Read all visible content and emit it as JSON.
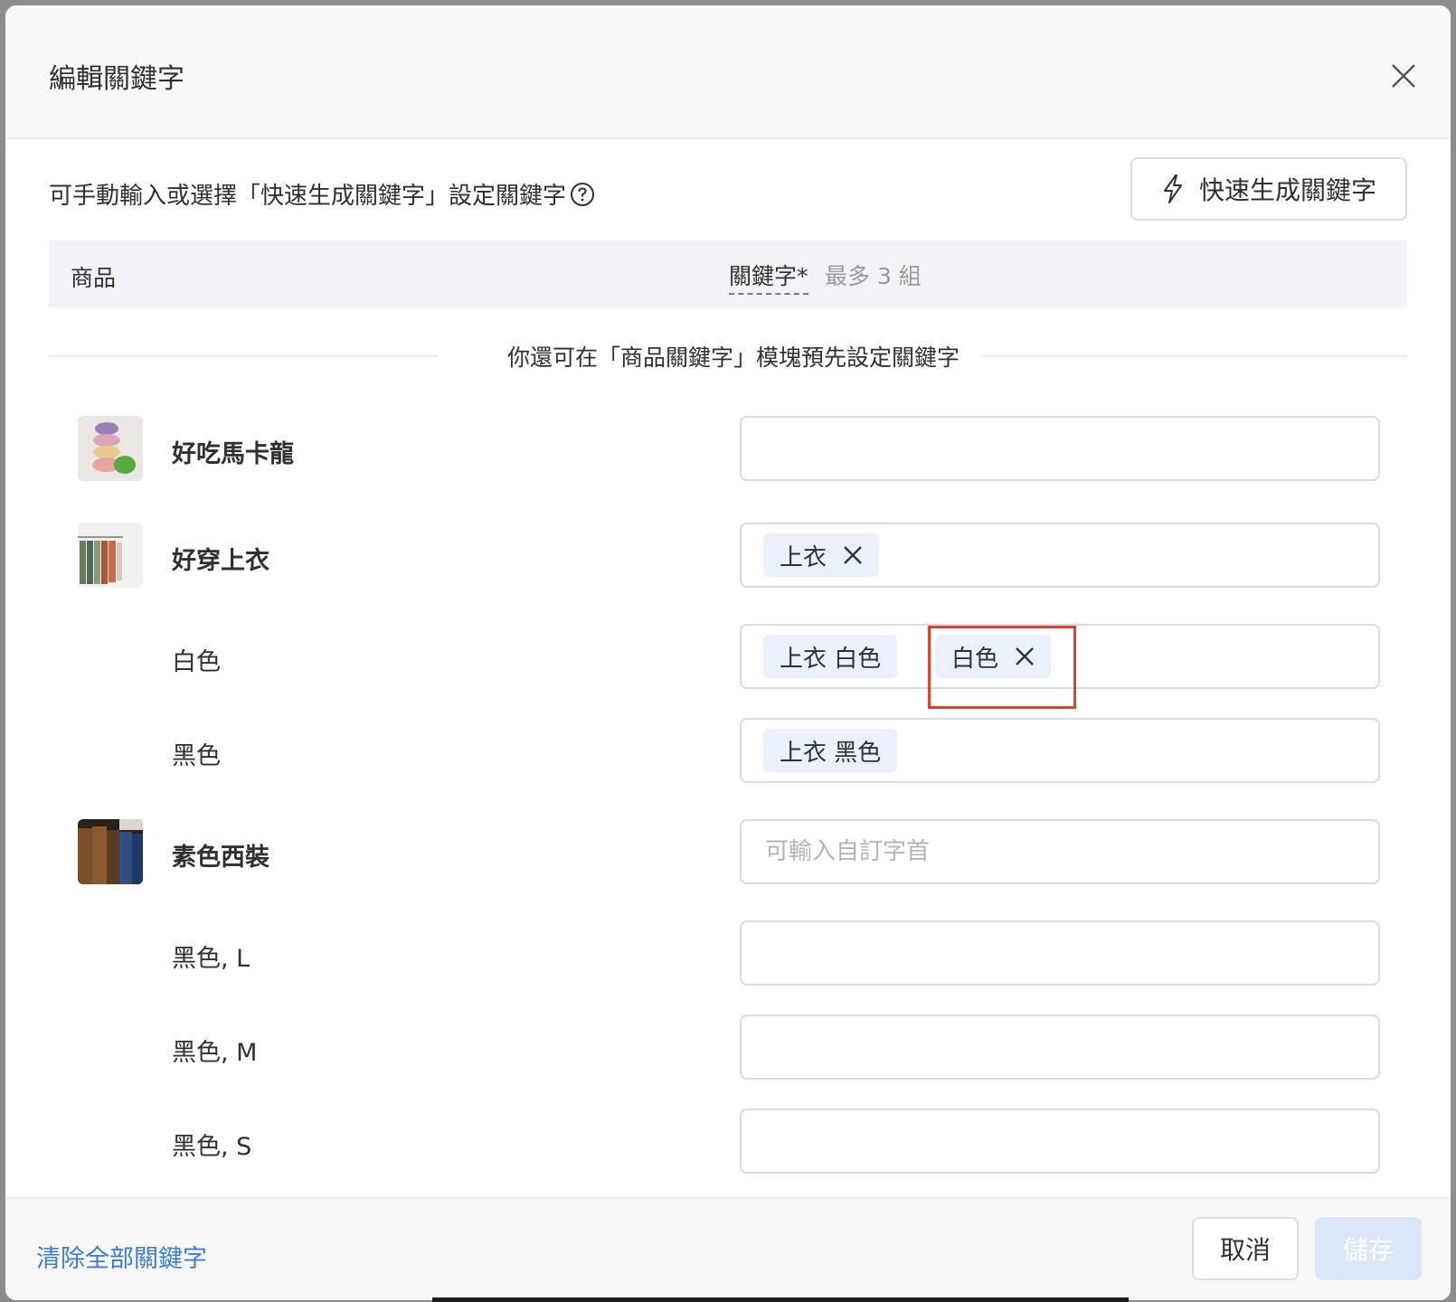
{
  "dialog": {
    "title": "編輯關鍵字",
    "intro": "可手動輸入或選擇「快速生成關鍵字」設定關鍵字",
    "quick_button": "快速生成關鍵字",
    "table_header": {
      "product": "商品",
      "keyword": "關鍵字*",
      "max_note": "最多 3 組"
    },
    "divider_text": "你還可在「商品關鍵字」模塊預先設定關鍵字",
    "rows": [
      {
        "name": "好吃馬卡龍",
        "tags": [],
        "placeholder": ""
      },
      {
        "name": "好穿上衣",
        "tags": [
          "上衣"
        ],
        "placeholder": ""
      },
      {
        "name": "白色",
        "tags": [
          "上衣 白色",
          "白色"
        ],
        "placeholder": ""
      },
      {
        "name": "黑色",
        "tags": [
          "上衣 黑色"
        ],
        "placeholder": ""
      },
      {
        "name": "素色西裝",
        "tags": [],
        "placeholder": "可輸入自訂字首"
      },
      {
        "name": "黑色, L",
        "tags": [],
        "placeholder": ""
      },
      {
        "name": "黑色, M",
        "tags": [],
        "placeholder": ""
      },
      {
        "name": "黑色, S",
        "tags": [],
        "placeholder": ""
      }
    ],
    "footer": {
      "clear_all": "清除全部關鍵字",
      "cancel": "取消",
      "save": "儲存"
    }
  },
  "colors": {
    "accent_link": "#3d7bd8",
    "tag_bg": "#eaf1fb",
    "highlight": "#e0412f",
    "save_disabled_bg": "#dbe7f9"
  }
}
